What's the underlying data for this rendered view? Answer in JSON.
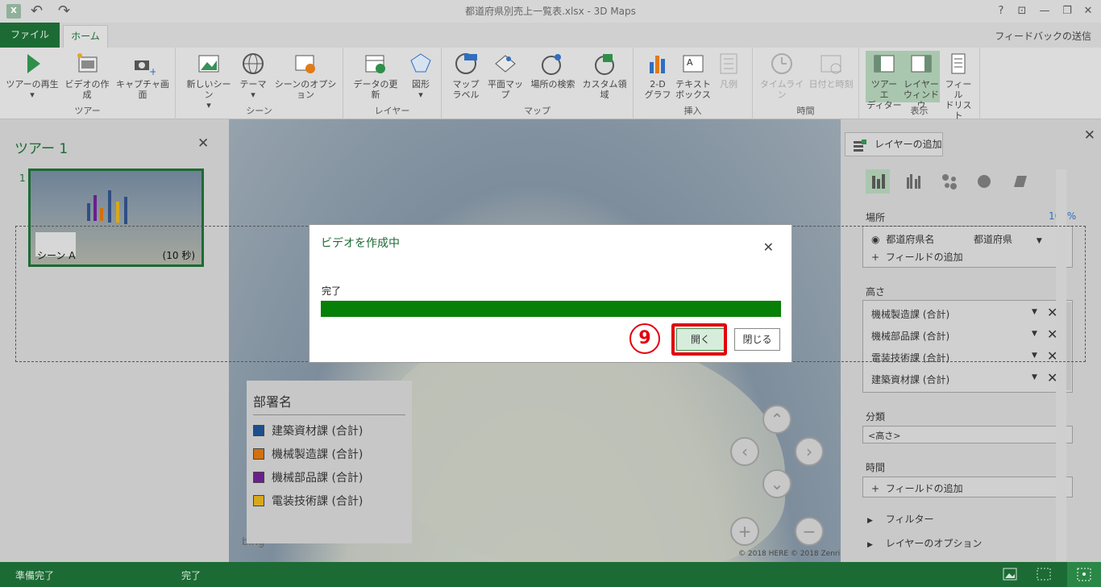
{
  "window": {
    "app_icon": "X",
    "title": "都道府県別売上一覧表.xlsx - 3D Maps",
    "help": "?",
    "restore_ribbon": "⊡",
    "minimize": "—",
    "maximize": "❐",
    "close": "✕"
  },
  "tabs": {
    "file": "ファイル",
    "home": "ホーム",
    "feedback": "フィードバックの送信"
  },
  "ribbon": {
    "tour_group": {
      "label": "ツアー",
      "play": "ツアーの再生",
      "video": "ビデオの作成",
      "capture": "キャプチャ画面"
    },
    "scene_group": {
      "label": "シーン",
      "new_scene": "新しいシーン",
      "theme": "テーマ",
      "scene_options": "シーンのオプション"
    },
    "layer_group": {
      "label": "レイヤー",
      "refresh": "データの更新",
      "shapes": "図形"
    },
    "map_group": {
      "label": "マップ",
      "map_labels_1": "マップ",
      "map_labels_2": "ラベル",
      "flat_map": "平面マップ",
      "find_location": "場所の検索",
      "custom_regions": "カスタム領域"
    },
    "insert_group": {
      "label": "挿入",
      "chart_1": "2-D",
      "chart_2": "グラフ",
      "textbox_1": "テキスト",
      "textbox_2": "ボックス",
      "legend": "凡例"
    },
    "time_group": {
      "label": "時間",
      "timeline": "タイムライン",
      "datetime": "日付と時刻"
    },
    "view_group": {
      "label": "表示",
      "tour_editor_1": "ツアー エ",
      "tour_editor_2": "ディター",
      "layer_pane_1": "レイヤー",
      "layer_pane_2": "ウィンドウ",
      "field_list_1": "フィール",
      "field_list_2": "ドリスト"
    }
  },
  "tour": {
    "title": "ツアー 1",
    "close": "✕",
    "scene_number": "1",
    "scene_name": "シーン A",
    "scene_duration": "(10 秒)"
  },
  "legend": {
    "title": "部署名",
    "items": [
      {
        "label": "建築資材課 (合計)",
        "color": "#1f4e8c"
      },
      {
        "label": "機械製造課 (合計)",
        "color": "#d2700f"
      },
      {
        "label": "機械部品課 (合計)",
        "color": "#6b1f8c"
      },
      {
        "label": "電装技術課 (合計)",
        "color": "#d8a81c"
      }
    ]
  },
  "map": {
    "attribution": "© 2018 HERE  © 2018 Zenrin",
    "bing": "bing",
    "nav": {
      "up": "⌃",
      "left": "‹",
      "right": "›",
      "down": "⌄",
      "zoom_in": "+",
      "zoom_out": "−"
    }
  },
  "layer_panel": {
    "close": "✕",
    "add_layer": "レイヤーの追加",
    "location": {
      "label": "場所",
      "percent": "100%",
      "field": "都道府県名",
      "type": "都道府県",
      "add_field": "フィールドの追加"
    },
    "height": {
      "label": "高さ",
      "fields": [
        "機械製造課 (合計)",
        "機械部品課 (合計)",
        "電装技術課 (合計)",
        "建築資材課 (合計)"
      ]
    },
    "category": {
      "label": "分類",
      "value": "<高さ>"
    },
    "time": {
      "label": "時間",
      "add_field": "フィールドの追加"
    },
    "filters": "フィルター",
    "layer_options": "レイヤーのオプション"
  },
  "status": {
    "ready": "準備完了",
    "done": "完了"
  },
  "dialog": {
    "title": "ビデオを作成中",
    "close": "✕",
    "status": "完了",
    "progress": 1.0,
    "open_button": "開く",
    "close_button": "閉じる"
  },
  "annotation": {
    "step": "9",
    "color": "#e3000f"
  }
}
